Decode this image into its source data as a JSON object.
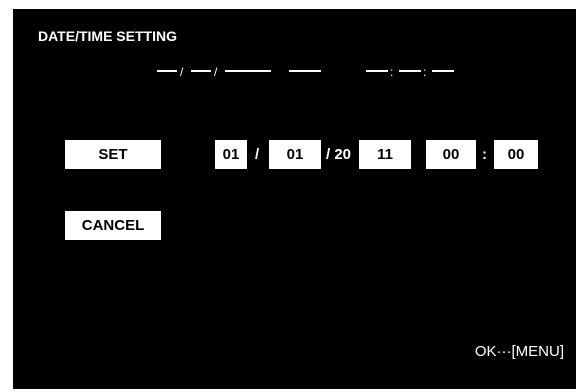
{
  "screen": {
    "title": "DATE/TIME SETTING"
  },
  "current_display": {
    "date_sep_1": "/",
    "date_sep_2": "/",
    "time_sep_1": ":",
    "time_sep_2": ":"
  },
  "controls": {
    "set_label": "SET",
    "cancel_label": "CANCEL"
  },
  "fields": {
    "month": "01",
    "sep_1": "/",
    "day": "01",
    "year_prefix": "/ 20",
    "year": "11",
    "hour": "00",
    "time_sep": ":",
    "minute": "00"
  },
  "footer": {
    "hint": "OK···[MENU]"
  },
  "colors": {
    "background": "#000000",
    "foreground": "#ffffff",
    "button_text": "#000000"
  }
}
